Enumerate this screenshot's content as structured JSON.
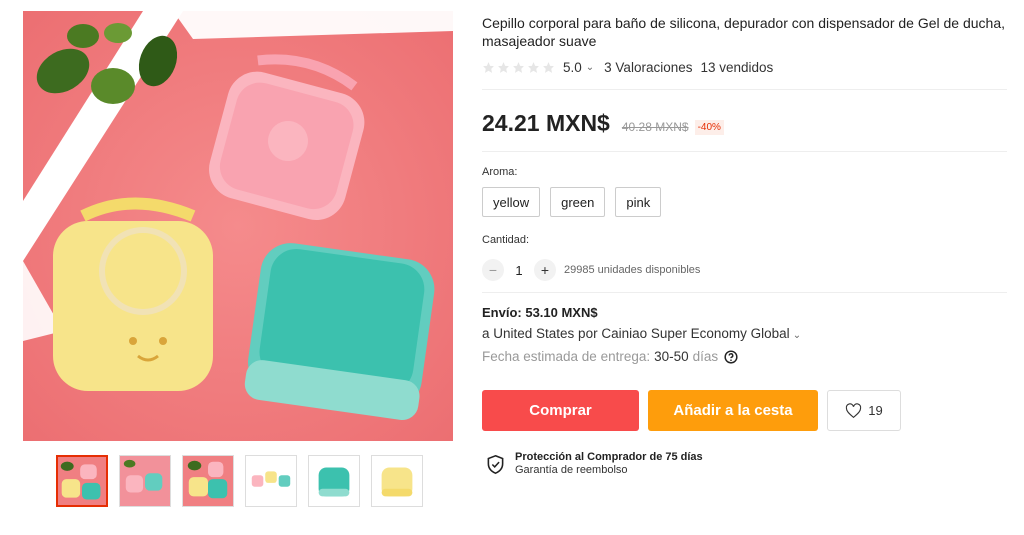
{
  "product": {
    "title": "Cepillo corporal para baño de silicona, depurador con dispensador de Gel de ducha, masajeador suave",
    "rating": {
      "score": "5.0",
      "reviews": "3 Valoraciones",
      "sold": "13 vendidos",
      "stars_filled": 0,
      "star_color": "#e6e6e6"
    },
    "price": {
      "current": "24.21 MXN$",
      "original": "40.28 MXN$",
      "discount": "-40%"
    },
    "aroma": {
      "label": "Aroma:",
      "options": [
        "yellow",
        "green",
        "pink"
      ]
    },
    "quantity": {
      "label": "Cantidad:",
      "value": "1",
      "available": "29985 unidades disponibles"
    },
    "shipping": {
      "title": "Envío: 53.10 MXN$",
      "to": "a United States por Cainiao Super Economy Global",
      "eta_prefix": "Fecha estimada de entrega:",
      "eta_days": "30-50",
      "eta_suffix": "días"
    },
    "actions": {
      "buy": "Comprar",
      "cart": "Añadir a la cesta",
      "wishlist_count": "19"
    },
    "protection": {
      "title": "Protección al Comprador de 75 días",
      "subtitle": "Garantía de reembolso"
    }
  },
  "gallery": {
    "thumbnail_count": 6,
    "active_index": 0
  },
  "colors": {
    "buy_button": "#f84b4b",
    "cart_button": "#fe9d0c",
    "discount": "#e62e04",
    "active_thumb_border": "#e62e04"
  },
  "icons": [
    "star-icon",
    "chevron-down-icon",
    "minus-icon",
    "plus-icon",
    "help-icon",
    "heart-icon",
    "shield-check-icon"
  ]
}
